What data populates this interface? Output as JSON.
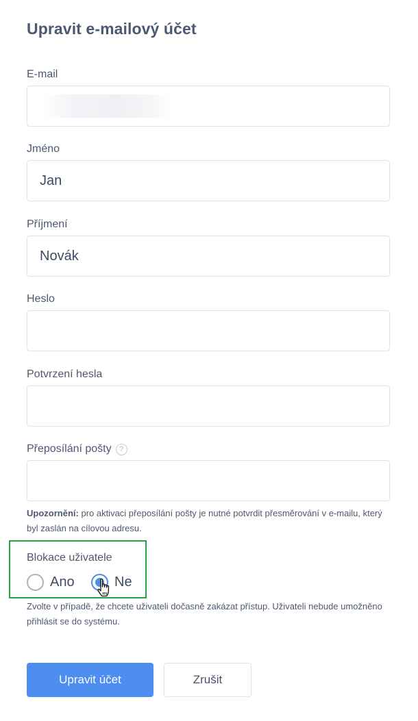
{
  "form": {
    "title": "Upravit e-mailový účet",
    "email": {
      "label": "E-mail",
      "value": ""
    },
    "first_name": {
      "label": "Jméno",
      "value": "Jan"
    },
    "last_name": {
      "label": "Příjmení",
      "value": "Novák"
    },
    "password": {
      "label": "Heslo",
      "value": ""
    },
    "password_confirm": {
      "label": "Potvrzení hesla",
      "value": ""
    },
    "forwarding": {
      "label": "Přeposílání pošty",
      "help_icon": "?",
      "value": ""
    },
    "forwarding_note": {
      "strong": "Upozornění:",
      "text": " pro aktivaci přeposílání pošty je nutné potvrdit přesměrování v e-mailu, který byl zaslán na cílovou adresu."
    },
    "block_user": {
      "label": "Blokace uživatele",
      "options": [
        "Ano",
        "Ne"
      ],
      "selected": "Ne",
      "note": "Zvolte v případě, že chcete uživateli dočasně zakázat přístup. Uživateli nebude umožněno přihlásit se do systému."
    },
    "submit_label": "Upravit účet",
    "cancel_label": "Zrušit"
  },
  "colors": {
    "primary": "#4d8ef0",
    "highlight_border": "#27a33b",
    "radio_checked": "#4d8ee9"
  }
}
